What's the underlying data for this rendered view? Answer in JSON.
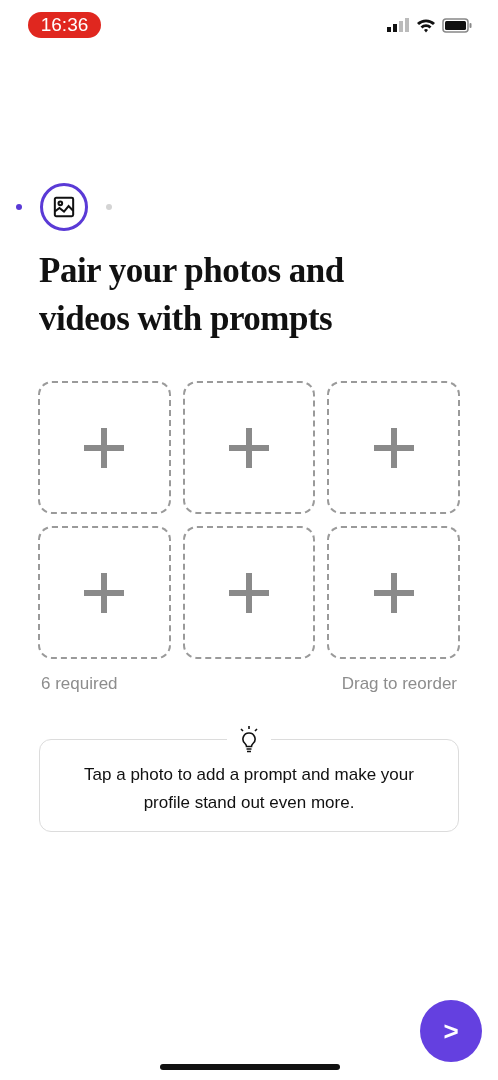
{
  "status_bar": {
    "time": "16:36"
  },
  "progress": {
    "steps": [
      {
        "kind": "dot",
        "selected": false,
        "done": true
      },
      {
        "kind": "icon",
        "selected": true
      },
      {
        "kind": "dot",
        "selected": false,
        "done": false
      }
    ]
  },
  "title": "Pair your photos and videos with prompts",
  "slots": [
    {
      "kind": "empty"
    },
    {
      "kind": "empty"
    },
    {
      "kind": "empty"
    },
    {
      "kind": "empty"
    },
    {
      "kind": "empty"
    },
    {
      "kind": "empty"
    }
  ],
  "grid_footer": {
    "left": "6 required",
    "right": "Drag to reorder"
  },
  "tip": {
    "text": "Tap a photo to add a prompt and make your profile stand out even more."
  },
  "next_button": {
    "label": ">"
  }
}
